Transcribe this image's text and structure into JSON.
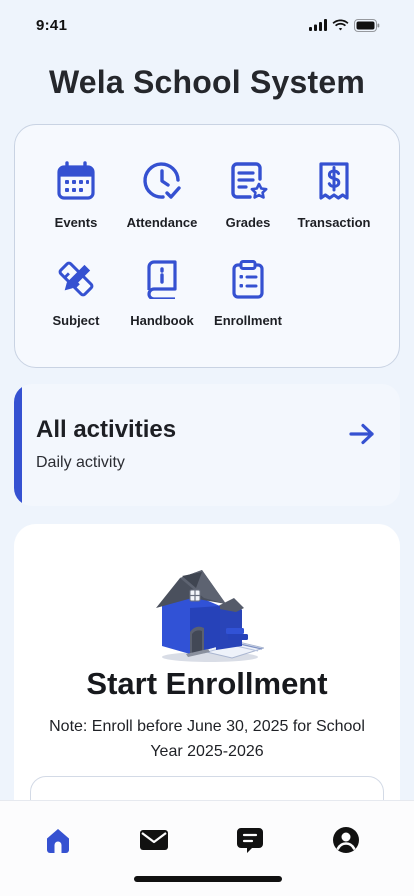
{
  "status_bar": {
    "time": "9:41"
  },
  "app": {
    "title": "Wela School System"
  },
  "menu": {
    "items": [
      {
        "label": "Events",
        "icon": "calendar-icon"
      },
      {
        "label": "Attendance",
        "icon": "clock-check-icon"
      },
      {
        "label": "Grades",
        "icon": "report-star-icon"
      },
      {
        "label": "Transaction",
        "icon": "receipt-dollar-icon"
      },
      {
        "label": "Subject",
        "icon": "pencil-ruler-icon"
      },
      {
        "label": "Handbook",
        "icon": "book-icon"
      },
      {
        "label": "Enrollment",
        "icon": "clipboard-icon"
      }
    ]
  },
  "activities": {
    "title": "All activities",
    "subtitle": "Daily activity"
  },
  "enrollment": {
    "title": "Start Enrollment",
    "note": "Note: Enroll before June 30, 2025 for School Year 2025-2026"
  },
  "bottom_nav": {
    "items": [
      {
        "name": "home",
        "icon": "home-icon",
        "active": true
      },
      {
        "name": "messages",
        "icon": "mail-icon",
        "active": false
      },
      {
        "name": "chat",
        "icon": "chat-icon",
        "active": false
      },
      {
        "name": "profile",
        "icon": "profile-icon",
        "active": false
      }
    ]
  },
  "colors": {
    "accent": "#3551d1",
    "background": "#eef4fc",
    "card": "#f6f9fe"
  }
}
